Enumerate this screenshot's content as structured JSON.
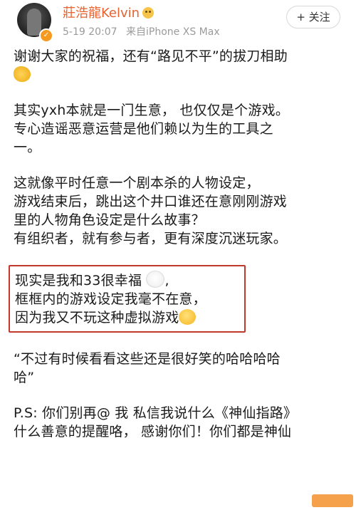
{
  "post": {
    "author": "莊浩龍Kelvin",
    "date": "5-19 20:07",
    "source": "来自iPhone XS Max",
    "follow_label": "+ 关注"
  },
  "content": {
    "p1": [
      "谢谢大家的祝福，还有“路见不平”的拔刀相助"
    ],
    "p2": [
      "其实yxh本就是一门生意， 也仅仅是个游戏。",
      "专心造谣恶意运营是他们赖以为生的工具之",
      "一。"
    ],
    "p3": [
      "这就像平时任意一个剧本杀的人物设定，",
      "游戏结束后，跳出这个井口谁还在意刚刚游戏",
      "里的人物角色设定是什么故事？",
      "有组织者，就有参与者，更有深度沉迷玩家。"
    ],
    "p4": [
      "现实是我和33很幸福",
      "框框内的游戏设定我毫不在意，",
      "因为我又不玩这种虚拟游戏"
    ],
    "p5": [
      "“不过有时候看看这些还是很好笑的哈哈哈哈",
      "哈”"
    ],
    "p6": [
      "P.S: 你们别再@ 我 私信我说什么《神仙指路》",
      "什么善意的提醒咯， 感谢你们！你们都是神仙"
    ]
  },
  "icons": {
    "vip": "vip-badge-icon",
    "handshake": "handshake-emoji-icon",
    "pray": "praying-hands-emoji-icon",
    "smile": "smiling-face-emoji-icon"
  },
  "colors": {
    "username": "#e8612e",
    "highlight_border": "#c0392b",
    "meta_text": "#9a9a9a"
  }
}
